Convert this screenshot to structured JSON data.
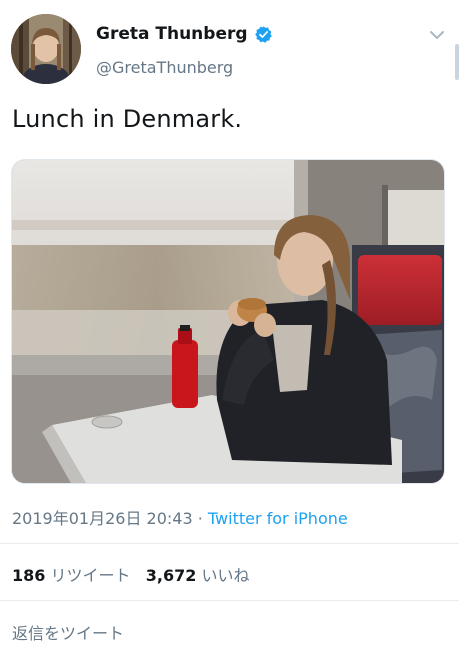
{
  "tweet": {
    "author": {
      "name": "Greta Thunberg",
      "handle": "@GretaThunberg",
      "verified": true
    },
    "text": "Lunch in Denmark.",
    "timestamp": "2019年01月26日 20:43",
    "separator": " · ",
    "source": "Twitter for iPhone",
    "stats": {
      "retweets": "186",
      "retweets_label": "リツイート",
      "likes": "3,672",
      "likes_label": "いいね"
    },
    "reply_placeholder": "返信をツイート"
  },
  "icons": {
    "verified": "verified-badge-icon",
    "menu": "chevron-down-icon"
  },
  "colors": {
    "accent": "#1da1f2",
    "secondary_text": "#657786",
    "primary_text": "#14171a",
    "divider": "#e6ecf0"
  }
}
